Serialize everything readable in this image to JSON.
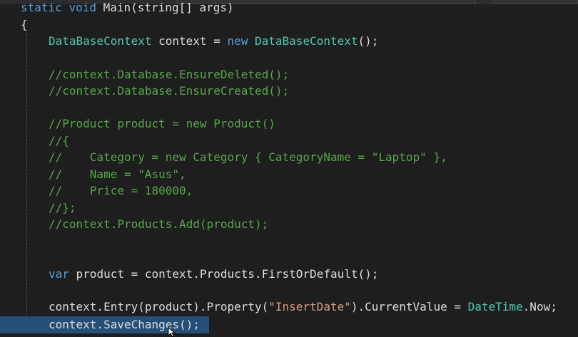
{
  "editor": {
    "navigation": {
      "class_combo": "",
      "method_combo": ""
    },
    "lines": {
      "l1": {
        "kw1": "static",
        "kw2": "void",
        "name": "Main(string[] args)"
      },
      "l2": {
        "brace": "{"
      },
      "l3": {
        "type1": "DataBaseContext",
        "mid": " context = ",
        "kw": "new",
        "type2": "DataBaseContext",
        "end": "();"
      },
      "l4": {
        "comment": "//context.Database.EnsureDeleted();"
      },
      "l5": {
        "comment": "//context.Database.EnsureCreated();"
      },
      "l6": {
        "comment": "//Product product = new Product()"
      },
      "l7": {
        "comment": "//{"
      },
      "l8": {
        "comment": "//    Category = new Category { CategoryName = \"Laptop\" },"
      },
      "l9": {
        "comment": "//    Name = \"Asus\","
      },
      "l10": {
        "comment": "//    Price = 180000,"
      },
      "l11": {
        "comment": "//};"
      },
      "l12": {
        "comment": "//context.Products.Add(product);"
      },
      "l13": {
        "kw": "var",
        "rest": " product = context.Products.FirstOrDefault();"
      },
      "l14": {
        "a": "context.Entry(product).Property(",
        "str": "\"InsertDate\"",
        "b": ").CurrentValue = ",
        "type": "DateTime",
        "c": ".Now;"
      },
      "l15": {
        "code": "context.SaveChanges();"
      }
    }
  },
  "colors": {
    "background": "#1e1e1e",
    "keyword": "#569cd6",
    "type": "#4ec9b0",
    "comment": "#57a64a",
    "string": "#d69d85",
    "text": "#dcdcdc",
    "selection": "#264f78"
  },
  "icons": {
    "pointer": "arrow-cursor-icon"
  }
}
